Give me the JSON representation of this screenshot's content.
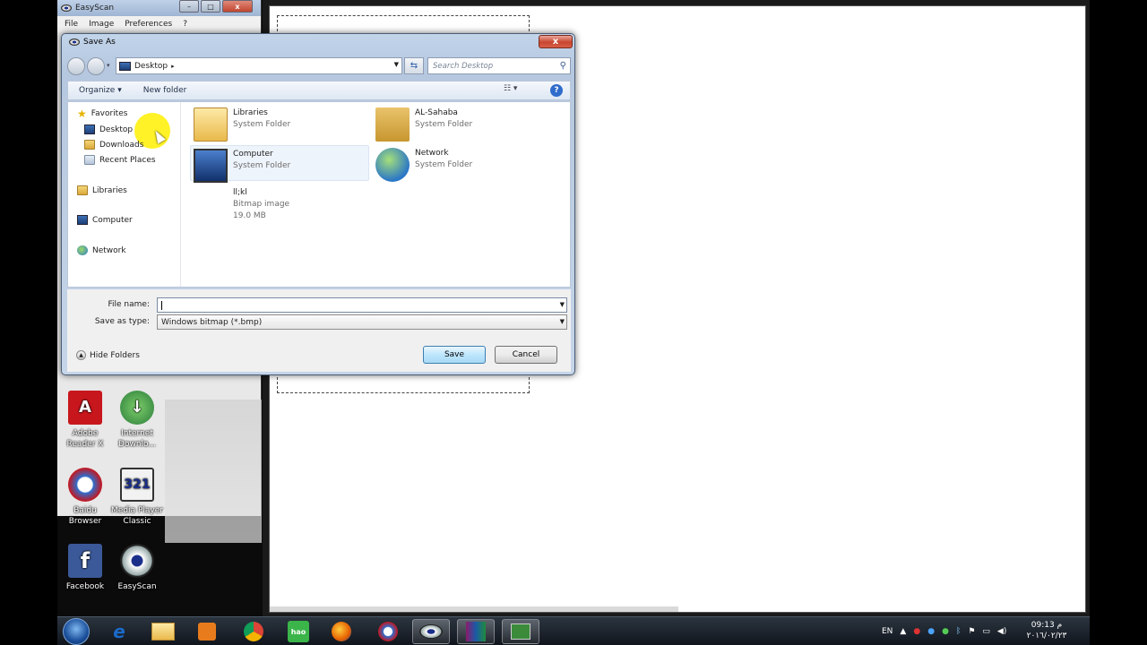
{
  "easyscan": {
    "title": "EasyScan",
    "menu": [
      "File",
      "Image",
      "Preferences",
      "?"
    ]
  },
  "desktop_icons": [
    {
      "label": "Adobe Reader X",
      "color": "#c8161d"
    },
    {
      "label": "Internet Downlo...",
      "color": "#2a7b3a"
    },
    {
      "label": "Baidu Browser",
      "color": "#2f6ccb"
    },
    {
      "label": "Media Player Classic",
      "color": "#444444"
    },
    {
      "label": "Facebook",
      "color": "#3b5998"
    },
    {
      "label": "EasyScan",
      "color": "#1a2e8a"
    }
  ],
  "dialog": {
    "title": "Save As",
    "address": "Desktop",
    "search_placeholder": "Search Desktop",
    "toolbar": {
      "organize": "Organize",
      "new_folder": "New folder"
    },
    "nav": {
      "favorites": "Favorites",
      "desktop": "Desktop",
      "downloads": "Downloads",
      "recent": "Recent Places",
      "libraries": "Libraries",
      "computer": "Computer",
      "network": "Network"
    },
    "files": [
      {
        "name": "Libraries",
        "type": "System Folder"
      },
      {
        "name": "AL-Sahaba",
        "type": "System Folder"
      },
      {
        "name": "Computer",
        "type": "System Folder"
      },
      {
        "name": "Network",
        "type": "System Folder"
      },
      {
        "name": "ll;kl",
        "type": "Bitmap image",
        "size": "19.0 MB"
      }
    ],
    "file_name_label": "File name:",
    "file_name_value": "",
    "save_type_label": "Save as type:",
    "save_type_value": "Windows bitmap (*.bmp)",
    "hide_folders": "Hide Folders",
    "save": "Save",
    "cancel": "Cancel"
  },
  "taskbar": {
    "language": "EN",
    "time": "09:13 م",
    "date": "٢٠١٦/٠٢/٢٣"
  }
}
